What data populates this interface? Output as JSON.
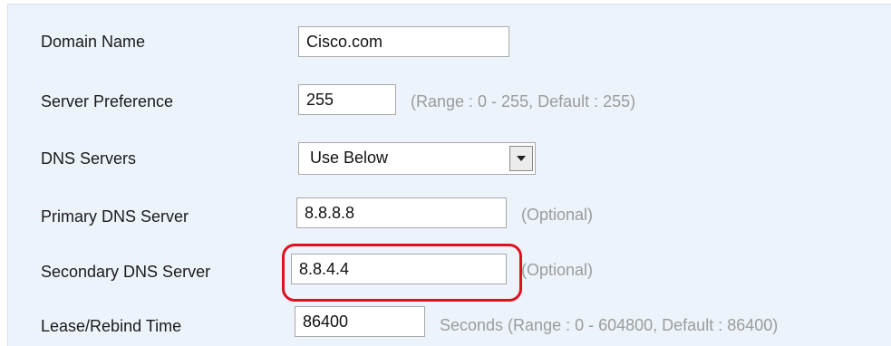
{
  "form": {
    "domain_name": {
      "label": "Domain Name",
      "value": "Cisco.com"
    },
    "server_preference": {
      "label": "Server Preference",
      "value": "255",
      "hint": "(Range : 0 - 255, Default : 255)"
    },
    "dns_servers": {
      "label": "DNS Servers",
      "selected": "Use Below"
    },
    "primary_dns": {
      "label": "Primary DNS Server",
      "value": "8.8.8.8",
      "hint": "(Optional)"
    },
    "secondary_dns": {
      "label": "Secondary DNS Server",
      "value": "8.8.4.4",
      "hint": "(Optional)"
    },
    "lease_time": {
      "label": "Lease/Rebind Time",
      "value": "86400",
      "hint": "Seconds (Range : 0 - 604800, Default : 86400)"
    }
  },
  "colors": {
    "panel_bg": "#edf3fb",
    "highlight": "#e0101e",
    "hint_text": "#9b9b9b"
  },
  "icons": {
    "dropdown": "chevron-down-icon"
  }
}
